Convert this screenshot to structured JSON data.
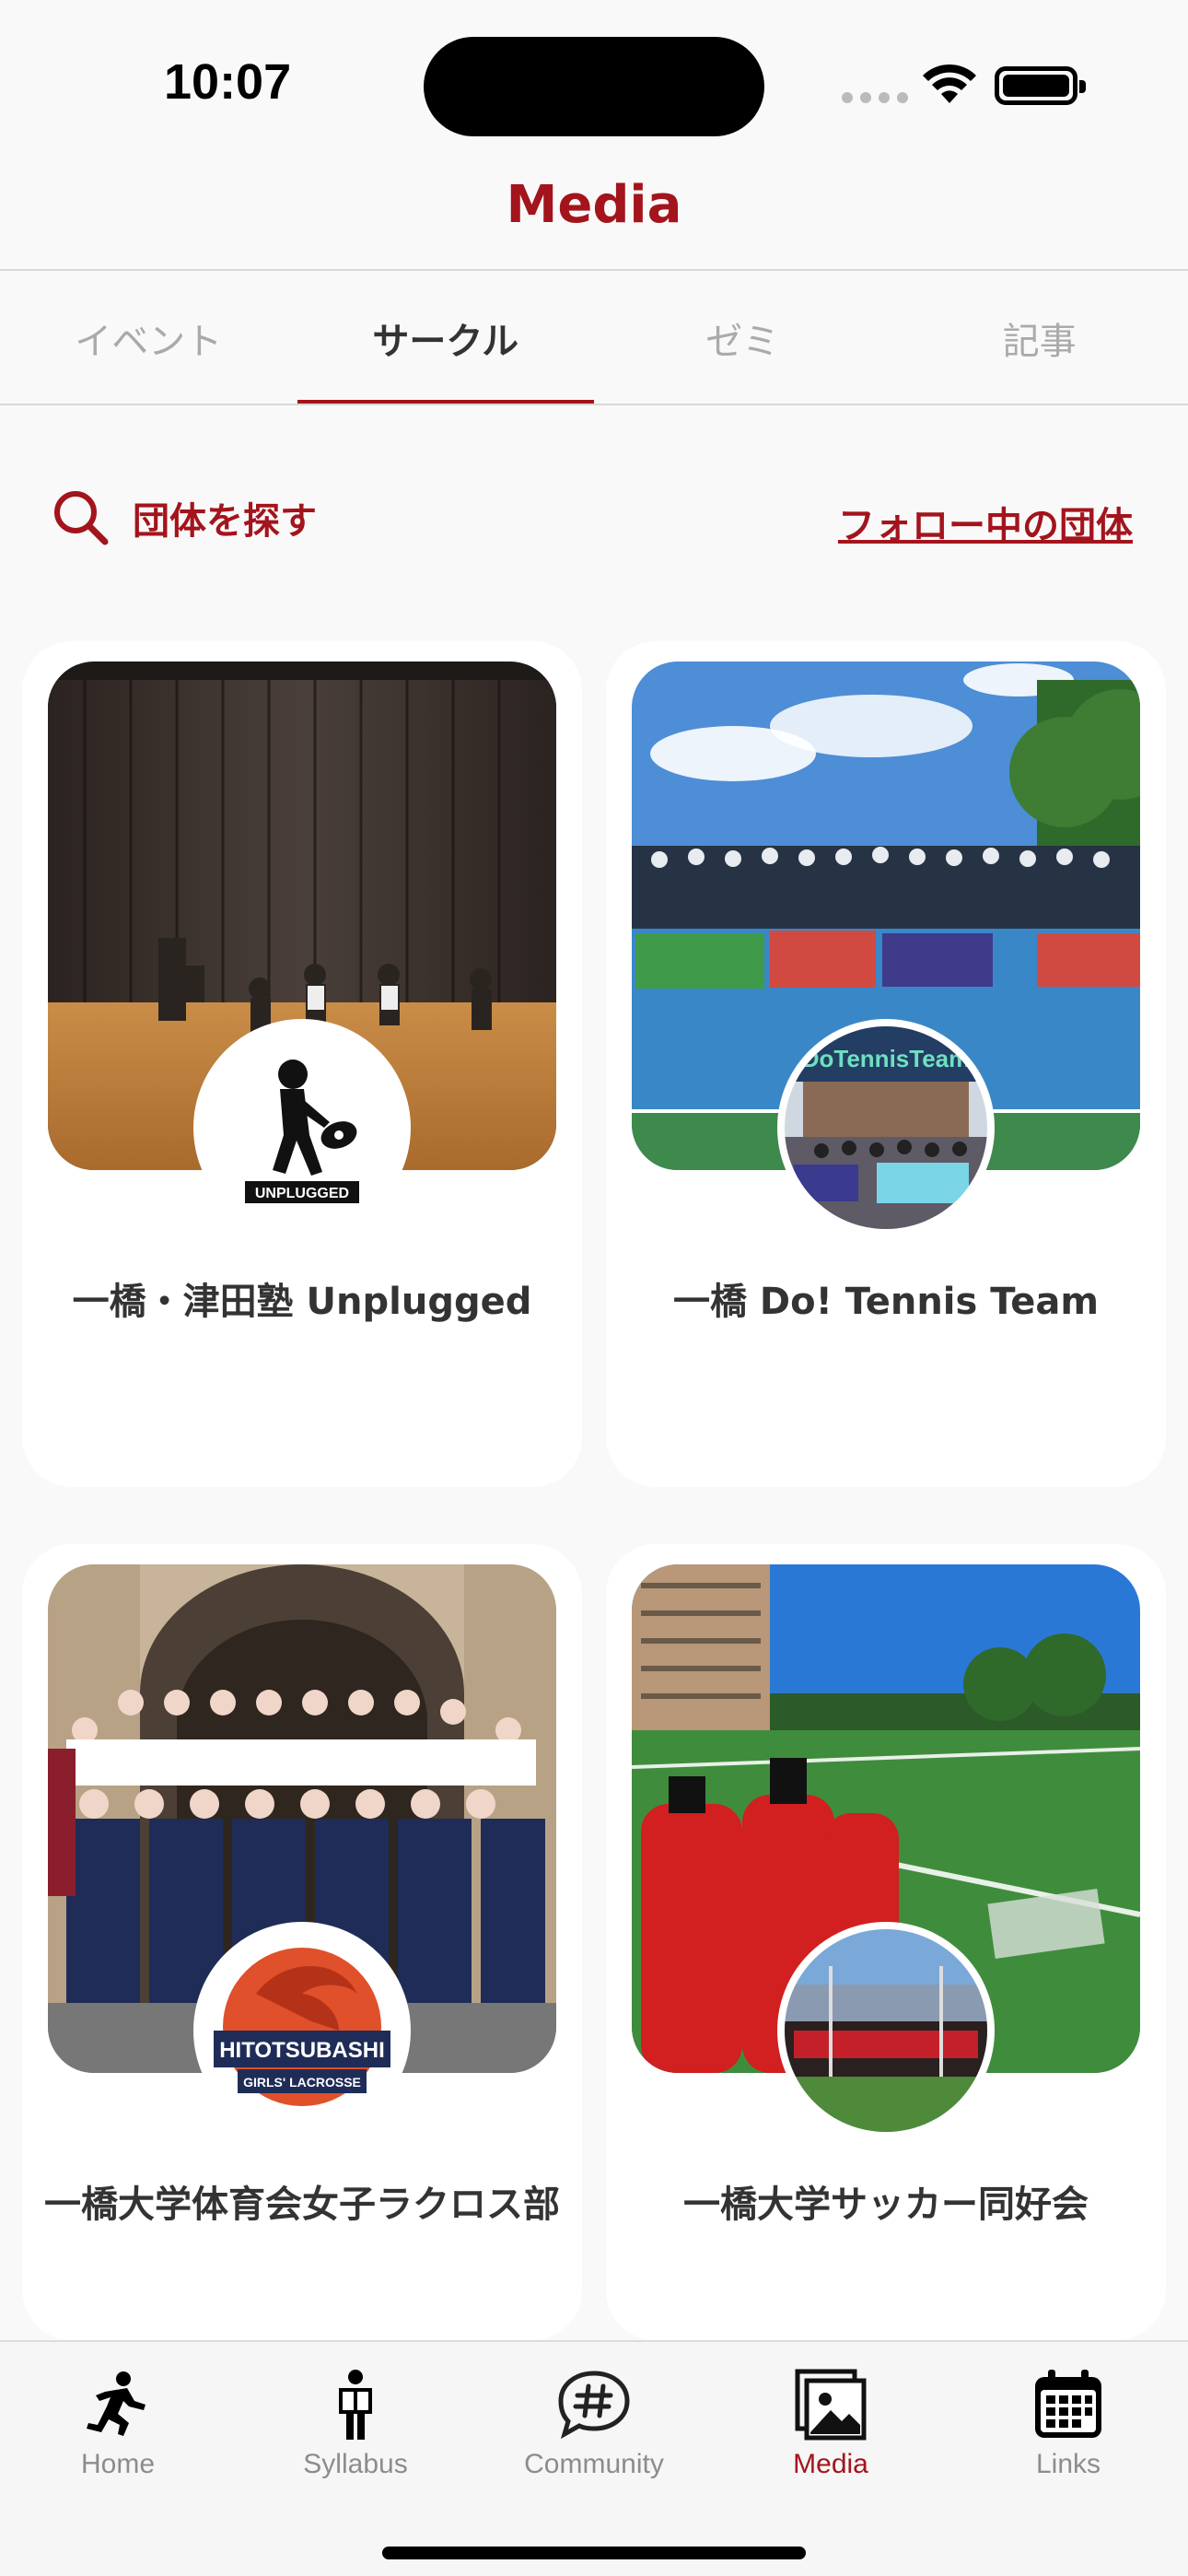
{
  "status": {
    "time": "10:07"
  },
  "header": {
    "title": "Media"
  },
  "tabs": [
    {
      "label": "イベント",
      "active": false
    },
    {
      "label": "サークル",
      "active": true
    },
    {
      "label": "ゼミ",
      "active": false
    },
    {
      "label": "記事",
      "active": false
    }
  ],
  "search": {
    "label": "団体を探す",
    "follow_link": "フォロー中の団体"
  },
  "cards": [
    {
      "name": "一橋・津田塾 Unplugged",
      "logo_text": "UNPLUGGED"
    },
    {
      "name": "一橋 Do! Tennis Team",
      "logo_text": "DoTennisTeam"
    },
    {
      "name": "一橋大学体育会女子ラクロス部",
      "logo_text": "HITOTSUBASHI",
      "logo_sub": "GIRLS' LACROSSE"
    },
    {
      "name": "一橋大学サッカー同好会"
    }
  ],
  "tabbar": [
    {
      "label": "Home",
      "icon": "runner-icon",
      "active": false
    },
    {
      "label": "Syllabus",
      "icon": "reader-icon",
      "active": false
    },
    {
      "label": "Community",
      "icon": "hashtag-bubble-icon",
      "active": false
    },
    {
      "label": "Media",
      "icon": "photo-icon",
      "active": true
    },
    {
      "label": "Links",
      "icon": "calendar-icon",
      "active": false
    }
  ],
  "colors": {
    "accent": "#a3141c",
    "inactive": "#8c8c8c"
  }
}
